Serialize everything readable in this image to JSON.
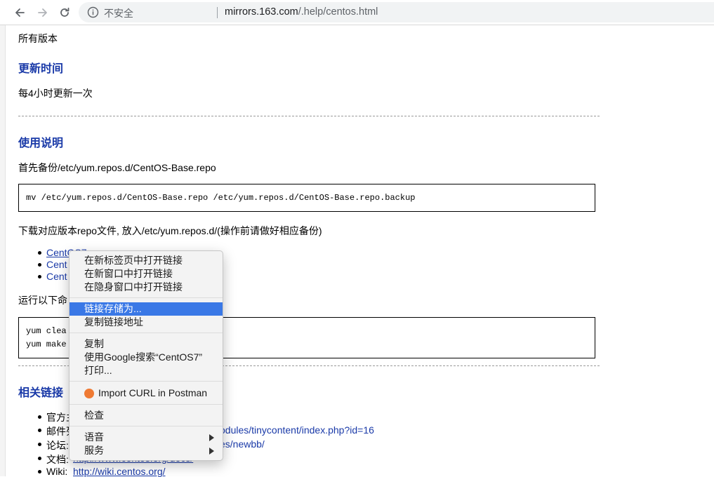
{
  "browser": {
    "security_label": "不安全",
    "url_host": "mirrors.163.com",
    "url_path": "/.help/centos.html"
  },
  "page": {
    "versions_text": "所有版本",
    "update_heading": "更新时间",
    "update_text": "每4小时更新一次",
    "usage_heading": "使用说明",
    "backup_text": "首先备份/etc/yum.repos.d/CentOS-Base.repo",
    "backup_command": "mv /etc/yum.repos.d/CentOS-Base.repo /etc/yum.repos.d/CentOS-Base.repo.backup",
    "download_text": "下载对应版本repo文件, 放入/etc/yum.repos.d/(操作前请做好相应备份)",
    "repo_links": [
      "CentOS7",
      "Cent",
      "Cent"
    ],
    "run_text": "运行以下命",
    "commands": [
      "yum clea",
      "yum make"
    ],
    "related_heading": "相关链接",
    "related": [
      {
        "label": "官方主",
        "link": ""
      },
      {
        "label": "邮件列",
        "link": "odules/tinycontent/index.php?id=16"
      },
      {
        "label": "论坛:",
        "link": "es/newbb/"
      },
      {
        "label": "文档:",
        "link": "http://www.centos.org/docs/"
      },
      {
        "label": "Wiki:",
        "link": "http://wiki.centos.org/"
      }
    ]
  },
  "context_menu": {
    "open_new_tab": "在新标签页中打开链接",
    "open_new_window": "在新窗口中打开链接",
    "open_incognito": "在隐身窗口中打开链接",
    "save_link_as": "链接存储为...",
    "copy_link": "复制链接地址",
    "copy": "复制",
    "search_google": "使用Google搜索“CentOS7”",
    "print": "打印...",
    "postman": "Import CURL in Postman",
    "inspect": "检查",
    "speech": "语音",
    "services": "服务"
  },
  "colors": {
    "link": "#1a3aa8",
    "menu_highlight": "#3a78e6",
    "postman": "#ef7a33"
  }
}
